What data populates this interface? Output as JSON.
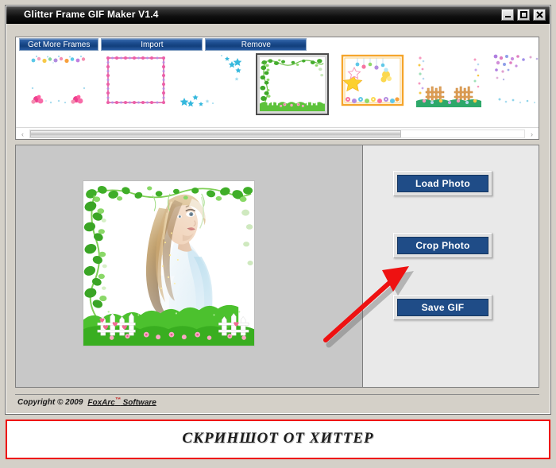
{
  "window": {
    "title": "Glitter Frame GIF Maker V1.4",
    "controls": [
      {
        "name": "minimize-button",
        "glyph": "minimize"
      },
      {
        "name": "maximize-button",
        "glyph": "maximize"
      },
      {
        "name": "close-button",
        "glyph": "close"
      }
    ]
  },
  "toolbar": {
    "get_more_frames": "Get More Frames",
    "import": "Import",
    "remove": "Remove"
  },
  "frames": {
    "scrollbar": {
      "left_arrow": "‹",
      "right_arrow": "›",
      "thumb_percent": 75
    },
    "selected_index": 3,
    "items": [
      {
        "id": "frame-1",
        "label": "Pastel hearts and flowers frame",
        "style": "hearts"
      },
      {
        "id": "frame-2",
        "label": "Pink diamond beaded border frame",
        "style": "beads"
      },
      {
        "id": "frame-3",
        "label": "Blue stars corner frame",
        "style": "stars-blue"
      },
      {
        "id": "frame-4",
        "label": "Green ivy and garden fence frame",
        "style": "ivy"
      },
      {
        "id": "frame-5",
        "label": "Orange stars and flowers frame",
        "style": "orange-stars"
      },
      {
        "id": "frame-6",
        "label": "Wooden fence and flowers frame",
        "style": "fence"
      },
      {
        "id": "frame-7",
        "label": "Purple confetti sparkle frame",
        "style": "confetti"
      }
    ]
  },
  "workspace": {
    "preview": {
      "label": "Photo preview with green ivy glitter frame",
      "frame_style": "ivy",
      "photo_alt": "Blonde woman in light blue and white dress"
    },
    "actions": [
      {
        "id": "load-photo",
        "label": "Load Photo"
      },
      {
        "id": "crop-photo",
        "label": "Crop Photo"
      },
      {
        "id": "save-gif",
        "label": "Save GIF"
      }
    ],
    "annotation": {
      "type": "red-arrow",
      "points_to": "crop-photo",
      "color": "#ee1111"
    }
  },
  "footer": {
    "copyright": "Copyright © 2009",
    "vendor": "FoxArc",
    "trademark": "™",
    "vendor_suffix": " Software"
  },
  "watermark": {
    "text": "СКРИНШОТ ОТ ХИТТЕР",
    "border_color": "#ee0000"
  },
  "colors": {
    "titlebar": "#000000",
    "window_face": "#d4d0c8",
    "panel_left": "#c8c8c8",
    "panel_right": "#e9e9e9",
    "button_blue": "#1f4c87",
    "toolbar_blue": "#1d4e90",
    "accent_red": "#ee0000"
  }
}
